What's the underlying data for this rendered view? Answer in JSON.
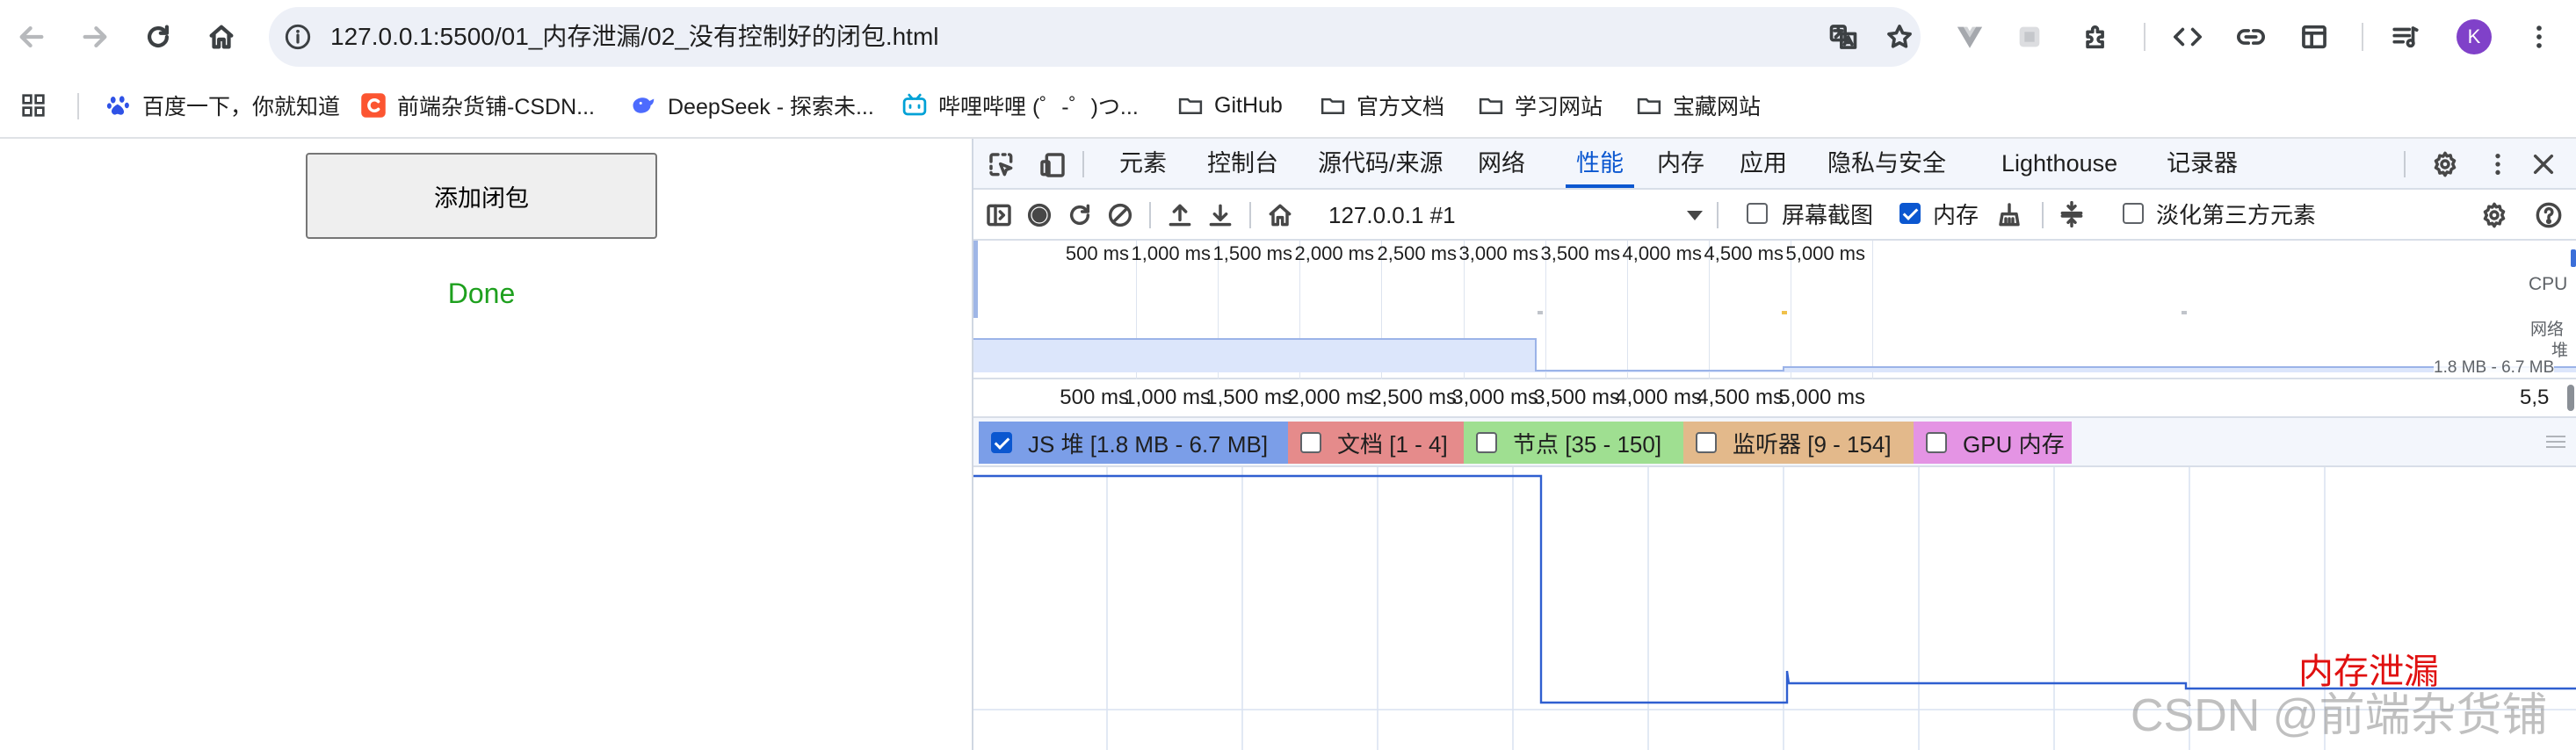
{
  "browser": {
    "url": "127.0.0.1:5500/01_内存泄漏/02_没有控制好的闭包.html",
    "avatar_letter": "K",
    "accent_color": "#0b57d0",
    "avatar_color": "#8041c9"
  },
  "bookmarks": [
    {
      "label": "百度一下，你就知道",
      "icon": "baidu-paw-icon"
    },
    {
      "label": "前端杂货铺-CSDN...",
      "icon": "csdn-logo-icon"
    },
    {
      "label": "DeepSeek - 探索未...",
      "icon": "deepseek-whale-icon"
    },
    {
      "label": "哔哩哔哩 (゜-゜)つ...",
      "icon": "bilibili-tv-icon"
    },
    {
      "label": "GitHub",
      "icon": "folder-icon"
    },
    {
      "label": "官方文档",
      "icon": "folder-icon"
    },
    {
      "label": "学习网站",
      "icon": "folder-icon"
    },
    {
      "label": "宝藏网站",
      "icon": "folder-icon"
    }
  ],
  "page": {
    "button_label": "添加闭包",
    "status_text": "Done",
    "status_color": "#1ea01e"
  },
  "devtools": {
    "tabs": [
      "元素",
      "控制台",
      "源代码/来源",
      "网络",
      "性能",
      "内存",
      "应用",
      "隐私与安全",
      "Lighthouse",
      "记录器"
    ],
    "active_tab": "性能",
    "target_select": "127.0.0.1 #1",
    "options": {
      "screenshots_label": "屏幕截图",
      "screenshots_checked": false,
      "memory_label": "内存",
      "memory_checked": true,
      "dim_third_party_label": "淡化第三方元素",
      "dim_third_party_checked": false
    },
    "overview": {
      "ticks": [
        "500 ms",
        "1,000 ms",
        "1,500 ms",
        "2,000 ms",
        "2,500 ms",
        "3,000 ms",
        "3,500 ms",
        "4,000 ms",
        "4,500 ms",
        "5,000 ms"
      ],
      "cpu_label": "CPU",
      "net_label": "网络",
      "heap_label": "堆",
      "heap_range": "1.8 MB - 6.7 MB"
    },
    "ruler": {
      "ticks": [
        "500 ms",
        "1,000 ms",
        "1,500 ms",
        "2,000 ms",
        "2,500 ms",
        "3,000 ms",
        "3,500 ms",
        "4,000 ms",
        "4,500 ms",
        "5,000 ms",
        "5,5"
      ]
    },
    "counters": [
      {
        "label": "JS 堆 [1.8 MB - 6.7 MB]",
        "checked": true,
        "color": "#7b9ee8"
      },
      {
        "label": "文档 [1 - 4]",
        "checked": false,
        "color": "#e58b8b"
      },
      {
        "label": "节点 [35 - 150]",
        "checked": false,
        "color": "#9fdf91"
      },
      {
        "label": "监听器 [9 - 154]",
        "checked": false,
        "color": "#e3b98b"
      },
      {
        "label": "GPU 内存",
        "checked": false,
        "color": "#e494e4"
      }
    ],
    "annotation": "内存泄漏",
    "annotation_color": "#e01010"
  },
  "watermark": "CSDN @前端杂货铺"
}
